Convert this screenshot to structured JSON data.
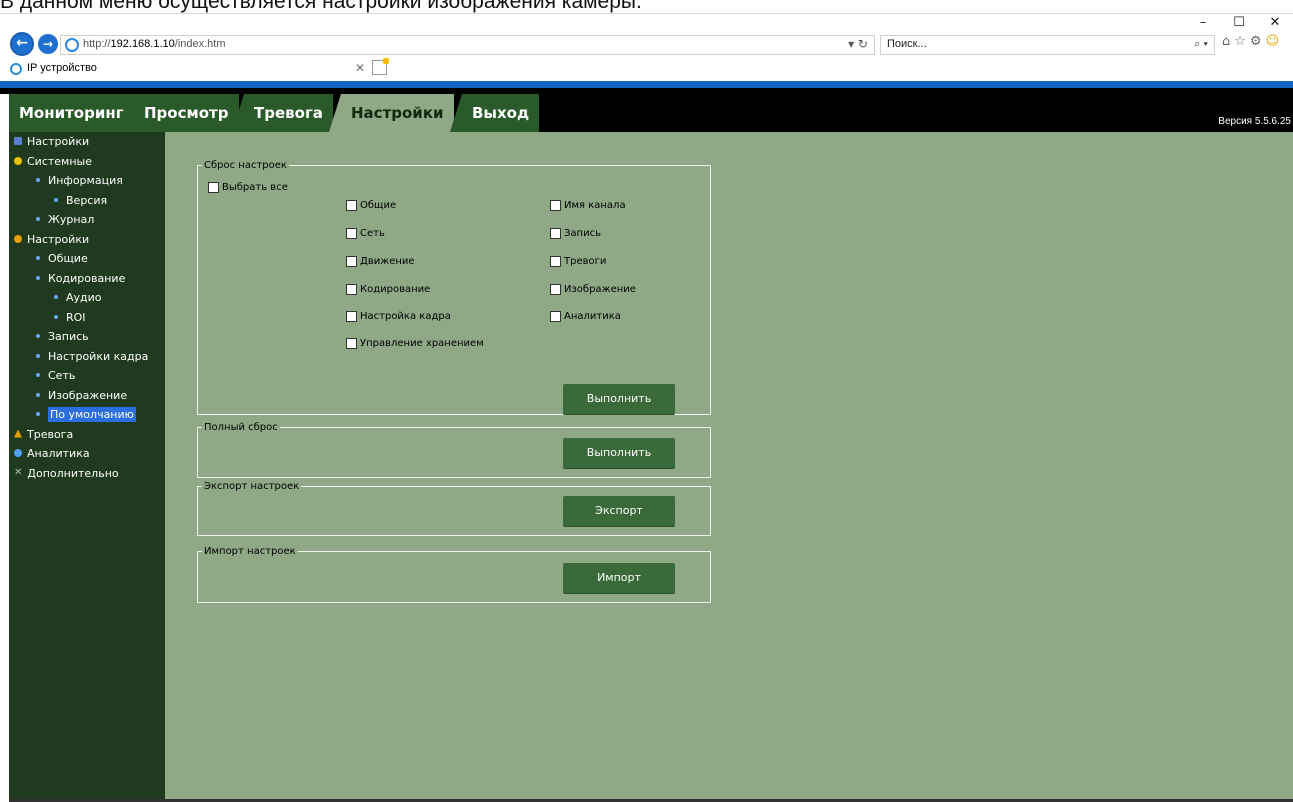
{
  "caption": "В данном меню осуществляется настройки изображения камеры.",
  "browser": {
    "window_controls": [
      "–",
      "☐",
      "✕"
    ],
    "url_prefix": "http://",
    "url_host": "192.168.1.10",
    "url_path": "/index.htm",
    "refresh_symbol": "▾ ↻",
    "search_placeholder": "Поиск...",
    "search_symbol": "⌕ ▾",
    "toolbar_icons": [
      "⌂",
      "☆",
      "⚙",
      "☺"
    ],
    "tab_title": "IP устройство",
    "tab_close": "✕"
  },
  "menu": {
    "items": [
      "Мониторинг",
      "Просмотр",
      "Тревога",
      "Настройки",
      "Выход"
    ],
    "active_index": 3,
    "version": "Версия 5.5.6.25"
  },
  "sidebar": {
    "items": [
      {
        "label": "Настройки",
        "level": 0,
        "icon": "book-icon"
      },
      {
        "label": "Системные",
        "level": 0,
        "icon": "info-icon"
      },
      {
        "label": "Информация",
        "level": 1
      },
      {
        "label": "Версия",
        "level": 2
      },
      {
        "label": "Журнал",
        "level": 1
      },
      {
        "label": "Настройки",
        "level": 0,
        "icon": "gear-icon"
      },
      {
        "label": "Общие",
        "level": 1
      },
      {
        "label": "Кодирование",
        "level": 1
      },
      {
        "label": "Аудио",
        "level": 2
      },
      {
        "label": "ROI",
        "level": 2
      },
      {
        "label": "Запись",
        "level": 1
      },
      {
        "label": "Настройки кадра",
        "level": 1
      },
      {
        "label": "Сеть",
        "level": 1
      },
      {
        "label": "Изображение",
        "level": 1
      },
      {
        "label": "По умолчанию",
        "level": 1,
        "selected": true
      },
      {
        "label": "Тревога",
        "level": 0,
        "icon": "alarm-icon"
      },
      {
        "label": "Аналитика",
        "level": 0,
        "icon": "analytics-icon"
      },
      {
        "label": "Дополнительно",
        "level": 0,
        "icon": "tools-icon"
      }
    ]
  },
  "reset": {
    "legend": "Сброс настроек",
    "select_all": "Выбрать все",
    "left_options": [
      "Общие",
      "Сеть",
      "Движение",
      "Кодирование",
      "Настройка кадра",
      "Управление хранением"
    ],
    "right_options": [
      "Имя канала",
      "Запись",
      "Тревоги",
      "Изображение",
      "Аналитика"
    ],
    "execute": "Выполнить"
  },
  "full_reset": {
    "legend": "Полный сброс",
    "execute": "Выполнить"
  },
  "export": {
    "legend": "Экспорт настроек",
    "button": "Экспорт"
  },
  "import": {
    "legend": "Импорт настроек",
    "button": "Импорт"
  },
  "colors": {
    "menu_active": "#8fa886",
    "sidebar_bg": "#1f3a1f",
    "content_bg": "#8fa886",
    "button_bg": "#3a6a3a",
    "selected": "#2a6fe0"
  }
}
